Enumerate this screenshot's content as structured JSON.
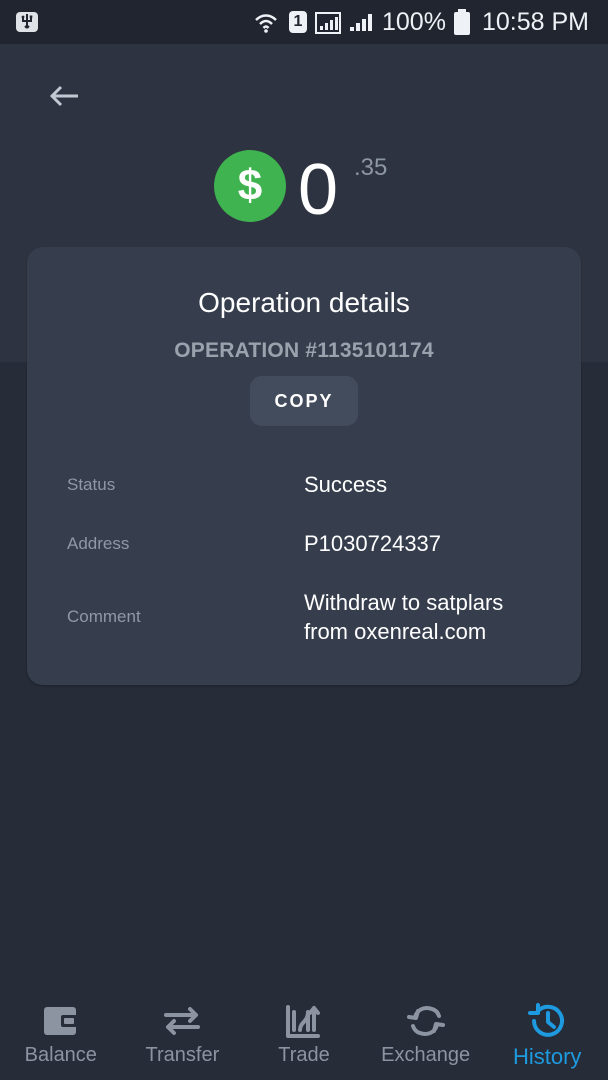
{
  "status_bar": {
    "battery": "100%",
    "time": "10:58 PM",
    "sim_slot": "1",
    "icons": [
      "usb-icon",
      "wifi-icon",
      "sim-1-icon",
      "signal-1-icon",
      "signal-2-icon",
      "battery-icon"
    ]
  },
  "header": {
    "back_icon": "arrow-left-icon",
    "currency_symbol": "$",
    "balance_integer": "0",
    "balance_fraction": ".35",
    "currency_color": "#3fb34f"
  },
  "card": {
    "title": "Operation details",
    "operation_label": "OPERATION #1135101174",
    "copy_label": "COPY",
    "details": [
      {
        "label": "Status",
        "value": "Success"
      },
      {
        "label": "Address",
        "value": "P1030724337"
      },
      {
        "label": "Comment",
        "value": "Withdraw to satplars from oxenreal.com"
      }
    ]
  },
  "bottom_nav": {
    "items": [
      {
        "label": "Balance",
        "icon": "wallet-icon",
        "active": false
      },
      {
        "label": "Transfer",
        "icon": "transfer-icon",
        "active": false
      },
      {
        "label": "Trade",
        "icon": "trade-icon",
        "active": false
      },
      {
        "label": "Exchange",
        "icon": "exchange-icon",
        "active": false
      },
      {
        "label": "History",
        "icon": "history-icon",
        "active": true
      }
    ],
    "active_color": "#1e9be0"
  }
}
